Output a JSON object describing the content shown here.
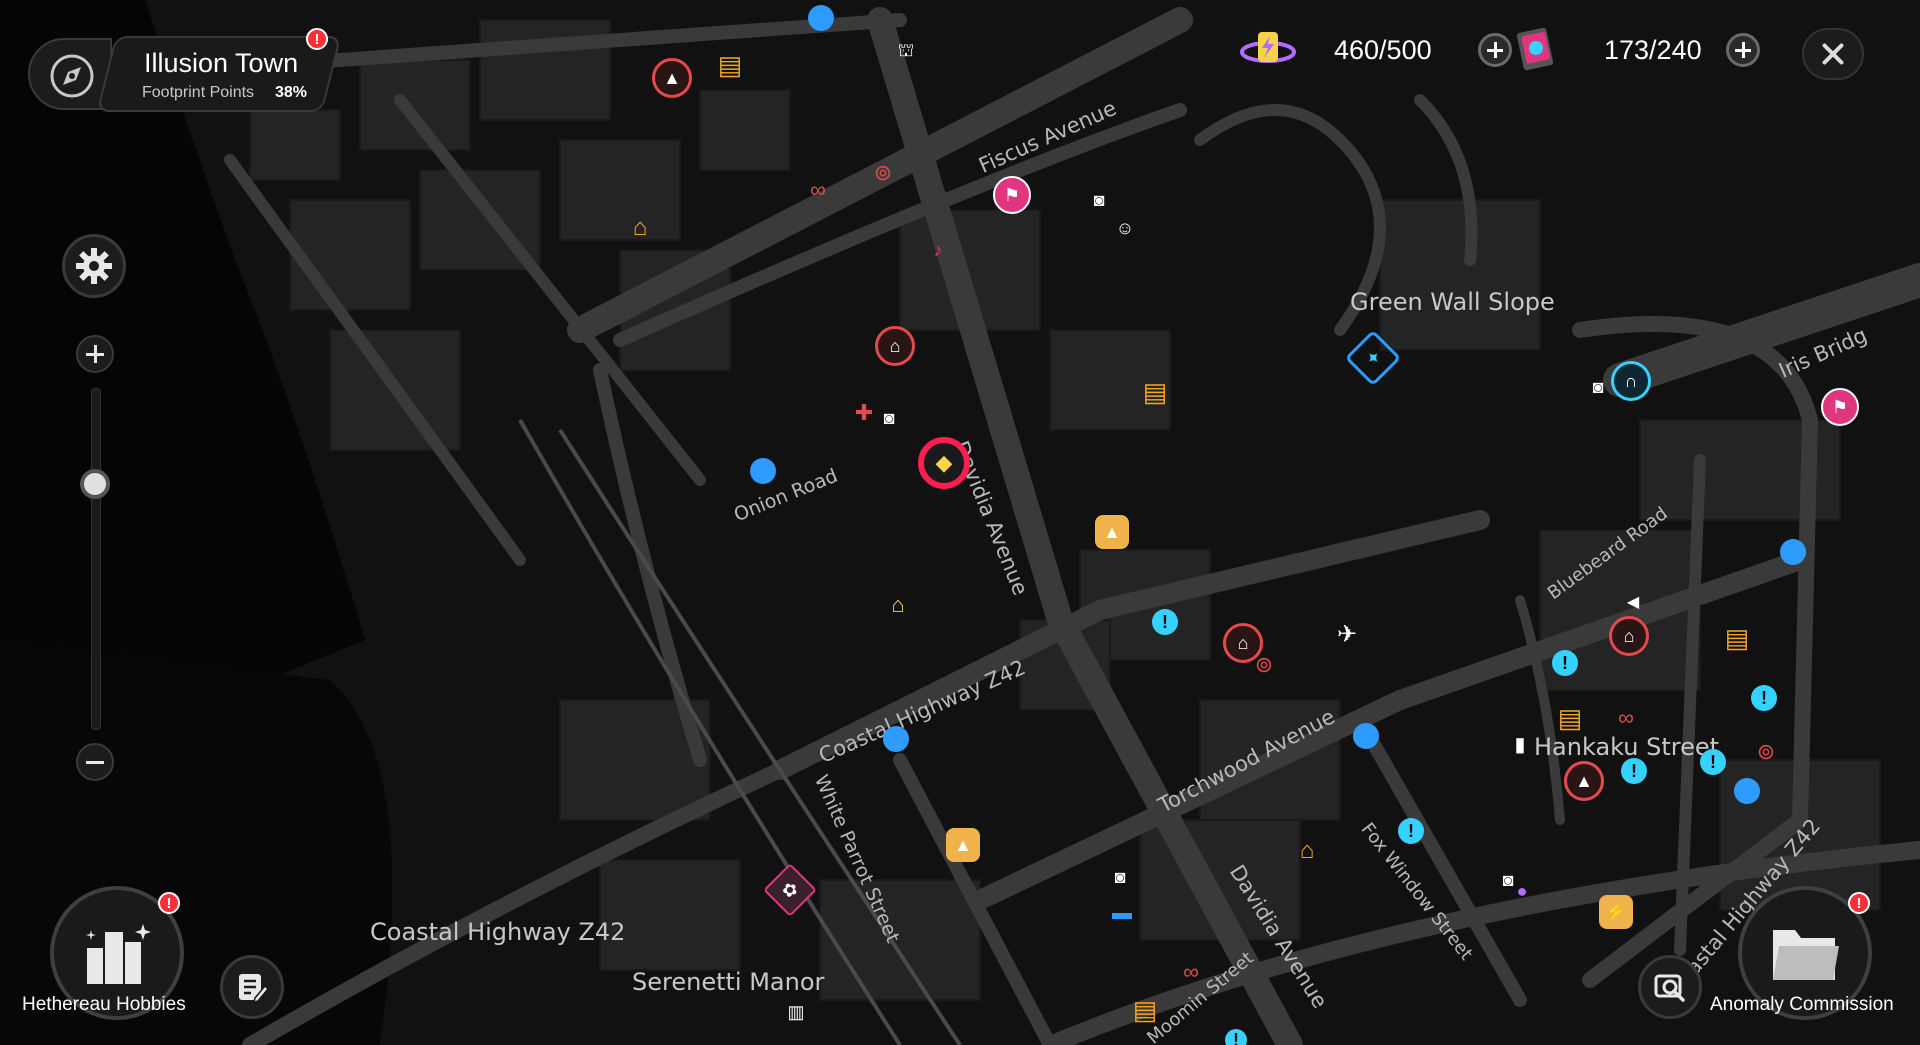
{
  "header": {
    "region_name": "Illusion Town",
    "footprint_label": "Footprint Points",
    "footprint_percent": "38%",
    "region_alert": "!"
  },
  "resources": {
    "energy": {
      "value": "460/500",
      "icon": "battery-charge-icon"
    },
    "film": {
      "value": "173/240",
      "icon": "film-card-icon"
    }
  },
  "map_labels": {
    "fiscus_avenue": "Fiscus Avenue",
    "green_wall_slope": "Green Wall Slope",
    "iris_bridge": "Iris Bridg",
    "onion_road": "Onion Road",
    "davidia_avenue_north": "Davidia Avenue",
    "bluebeard_road": "Bluebeard Road",
    "coastal_highway_diag": "Coastal Highway Z42",
    "torchwood_avenue": "Torchwood Avenue",
    "hankaku_street": "Hankaku Street",
    "white_parrot_street": "White Parrot Street",
    "fox_window_street": "Fox Window Street",
    "davidia_avenue_south": "Davidia Avenue",
    "coastal_highway_east": "astal Highway Z42",
    "coastal_highway_west": "Coastal Highway Z42",
    "serenetti_manor": "Serenetti Manor",
    "moomin_street": "Moomin Street"
  },
  "bottom": {
    "hobbies_label": "Hethereau Hobbies",
    "hobbies_alert": "!",
    "commission_label": "Anomaly Commission",
    "commission_alert": "!"
  },
  "colors": {
    "player_marker": "#ff1e4e",
    "shop": "#f5a623",
    "quest_blue": "#2e9bff",
    "tele_red": "#e5484d",
    "landmark_pink": "#e0357f",
    "cyan_hint": "#35d1ff"
  }
}
